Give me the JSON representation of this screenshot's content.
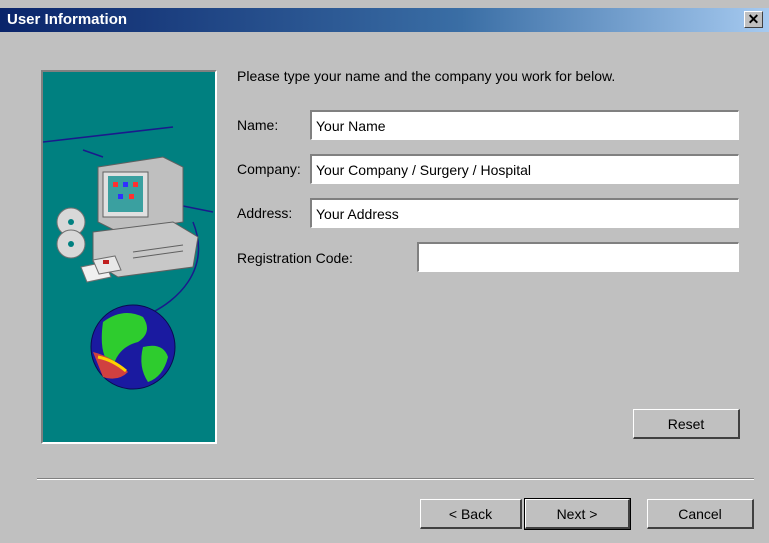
{
  "window": {
    "title": "User Information",
    "close_glyph": "✕"
  },
  "form": {
    "instructions": "Please type your name and the company you work for below.",
    "name_label": "Name:",
    "name_value": "Your Name",
    "company_label": "Company:",
    "company_value": "Your Company / Surgery / Hospital",
    "address_label": "Address:",
    "address_value": "Your Address",
    "regcode_label": "Registration Code:",
    "regcode_value": ""
  },
  "buttons": {
    "reset": "Reset",
    "back": "< Back",
    "next": "Next >",
    "cancel": "Cancel"
  },
  "colors": {
    "title_bar": "#0a246a",
    "art_background": "#008080",
    "dialog_face": "#c0c0c0"
  }
}
